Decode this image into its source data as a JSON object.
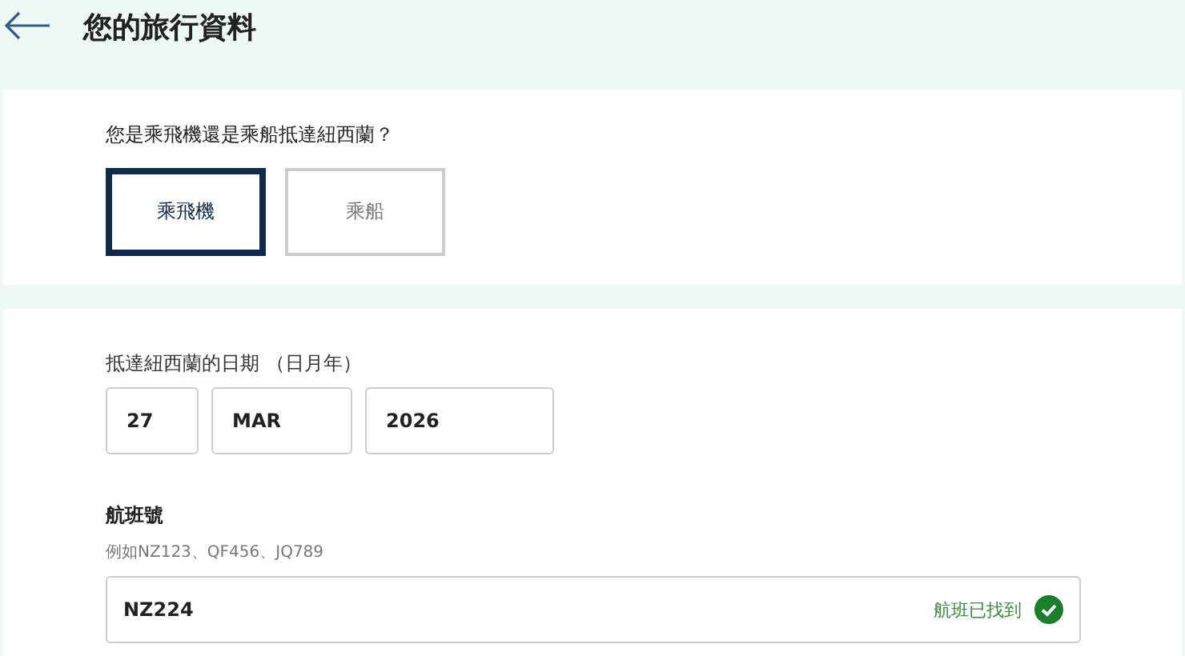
{
  "header": {
    "title": "您的旅行資料"
  },
  "arrival_mode": {
    "question": "您是乘飛機還是乘船抵達紐西蘭？",
    "options": [
      {
        "label": "乘飛機",
        "selected": true
      },
      {
        "label": "乘船",
        "selected": false
      }
    ]
  },
  "arrival_date": {
    "label": "抵達紐西蘭的日期 （日月年）",
    "day": "27",
    "month": "MAR",
    "year": "2026"
  },
  "flight": {
    "label": "航班號",
    "hint": "例如NZ123、QF456、JQ789",
    "value": "NZ224",
    "status": "航班已找到",
    "found": true
  }
}
